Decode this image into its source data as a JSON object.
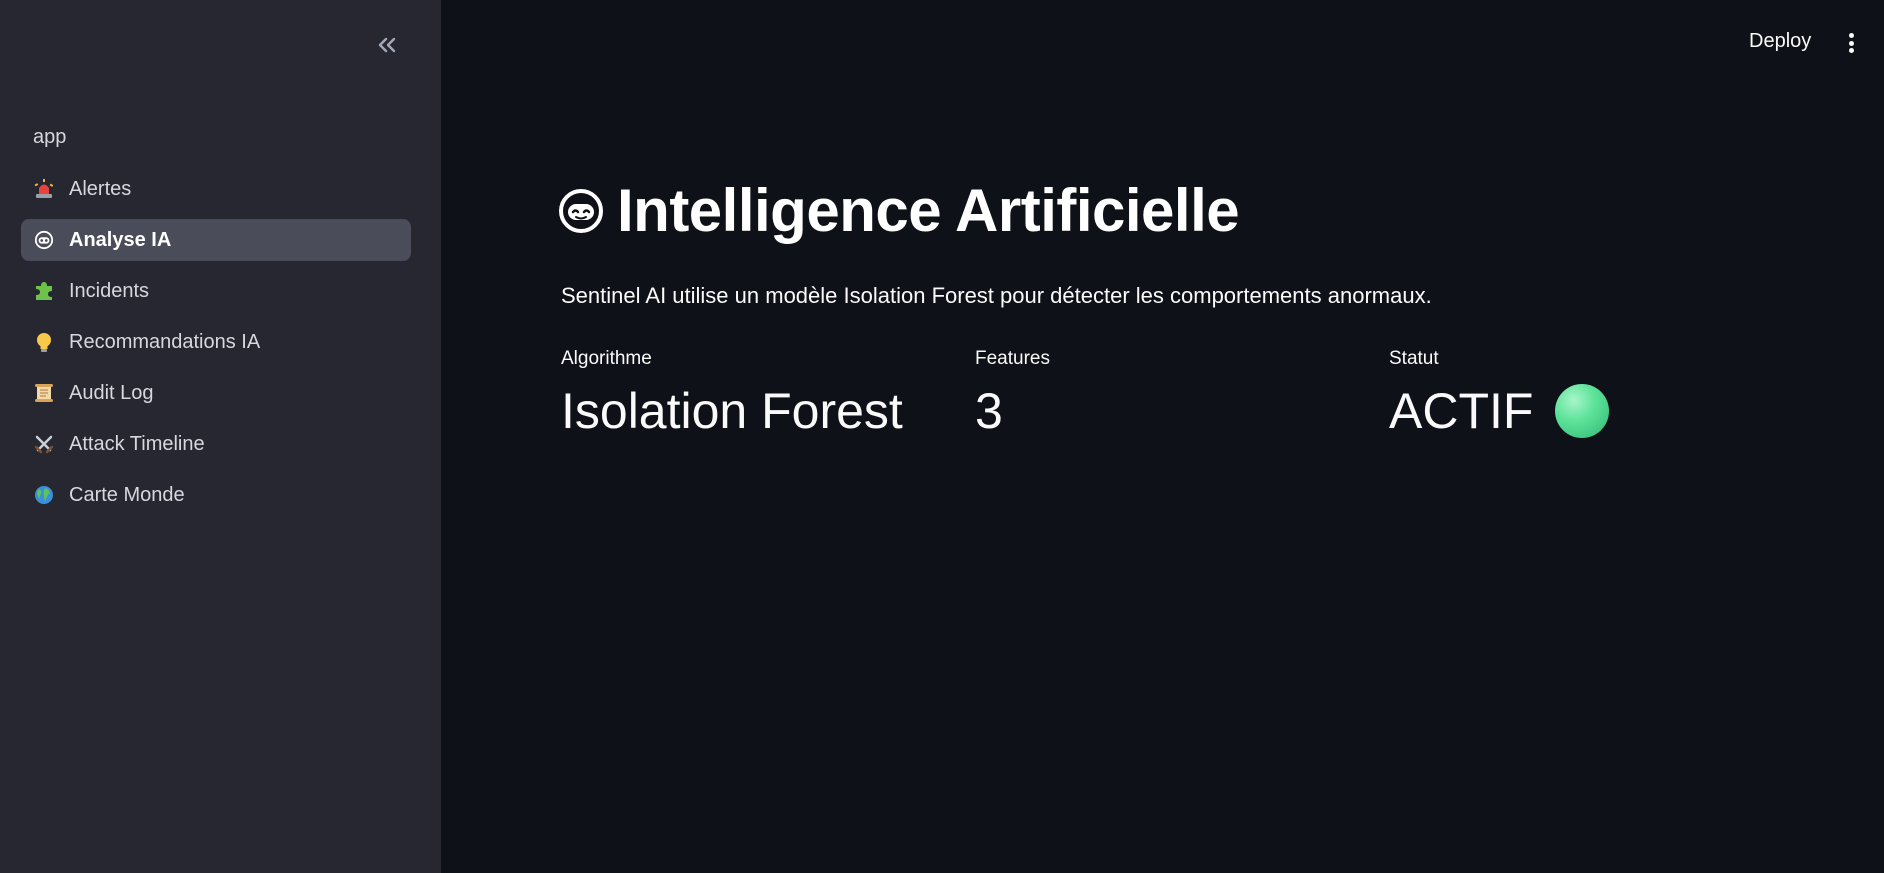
{
  "sidebar": {
    "section_label": "app",
    "items": [
      {
        "label": "Alertes",
        "icon": "police-light-icon",
        "active": false
      },
      {
        "label": "Analyse IA",
        "icon": "robot-face-icon",
        "active": true
      },
      {
        "label": "Incidents",
        "icon": "puzzle-piece-icon",
        "active": false
      },
      {
        "label": "Recommandations IA",
        "icon": "lightbulb-icon",
        "active": false
      },
      {
        "label": "Audit Log",
        "icon": "scroll-icon",
        "active": false
      },
      {
        "label": "Attack Timeline",
        "icon": "crossed-swords-icon",
        "active": false
      },
      {
        "label": "Carte Monde",
        "icon": "globe-icon",
        "active": false
      }
    ]
  },
  "header": {
    "deploy_label": "Deploy"
  },
  "main": {
    "title": "Intelligence Artificielle",
    "title_icon": "robot-face-icon",
    "description": "Sentinel AI utilise un modèle Isolation Forest pour détecter les comportements anormaux.",
    "metrics": [
      {
        "label": "Algorithme",
        "value": "Isolation Forest"
      },
      {
        "label": "Features",
        "value": "3"
      },
      {
        "label": "Statut",
        "value": "ACTIF",
        "status_color": "#5ee39a"
      }
    ]
  },
  "colors": {
    "sidebar_bg": "#262730",
    "main_bg": "#0e1117",
    "active_item_bg": "#4a4c5a"
  }
}
